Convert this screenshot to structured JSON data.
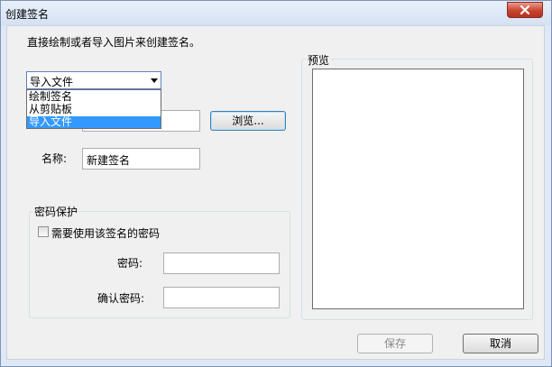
{
  "window": {
    "title": "创建签名"
  },
  "instruction": "直接绘制或者导入图片来创建签名。",
  "source_combo": {
    "selected": "导入文件",
    "options": [
      "绘制签名",
      "从剪贴板",
      "导入文件"
    ],
    "highlighted_index": 2
  },
  "file": {
    "value": "",
    "browse_label": "浏览..."
  },
  "name": {
    "label": "名称:",
    "value": "新建签名"
  },
  "password_group": {
    "legend": "密码保护",
    "checkbox_label": "需要使用该签名的密码",
    "checked": false,
    "password_label": "密码:",
    "confirm_label": "确认密码:"
  },
  "preview": {
    "legend": "预览"
  },
  "buttons": {
    "save": "保存",
    "cancel": "取消"
  }
}
